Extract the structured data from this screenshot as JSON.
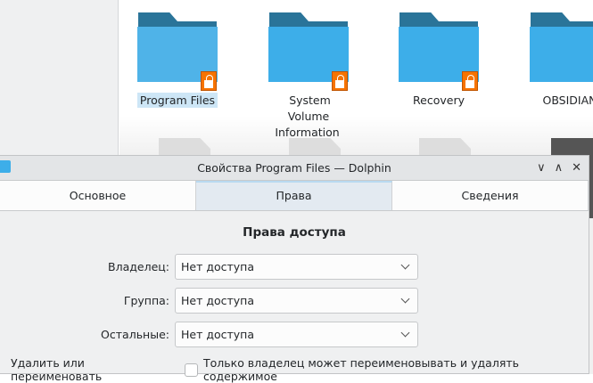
{
  "files": [
    {
      "name": "Program Files",
      "locked": true,
      "selected": true
    },
    {
      "name": "System Volume Information",
      "locked": true,
      "selected": false
    },
    {
      "name": "Recovery",
      "locked": true,
      "selected": false
    },
    {
      "name": "OBSIDIAN",
      "locked": false,
      "selected": false
    }
  ],
  "dialog": {
    "title": "Свойства Program Files — Dolphin",
    "tabs": [
      {
        "label": "Основное"
      },
      {
        "label": "Права",
        "active": true
      },
      {
        "label": "Сведения"
      }
    ],
    "heading": "Права доступа",
    "owner": {
      "label": "Владелец:",
      "value": "Нет доступа"
    },
    "group": {
      "label": "Группа:",
      "value": "Нет доступа"
    },
    "others": {
      "label": "Остальные:",
      "value": "Нет доступа"
    },
    "delete": {
      "label": "Удалить или переименовать",
      "checkbox_label": "Только владелец может переименовывать и удалять содержимое",
      "checked": false
    }
  },
  "colors": {
    "accent": "#3daee9",
    "lock": "#f67400",
    "selection": "#cde6f6"
  }
}
